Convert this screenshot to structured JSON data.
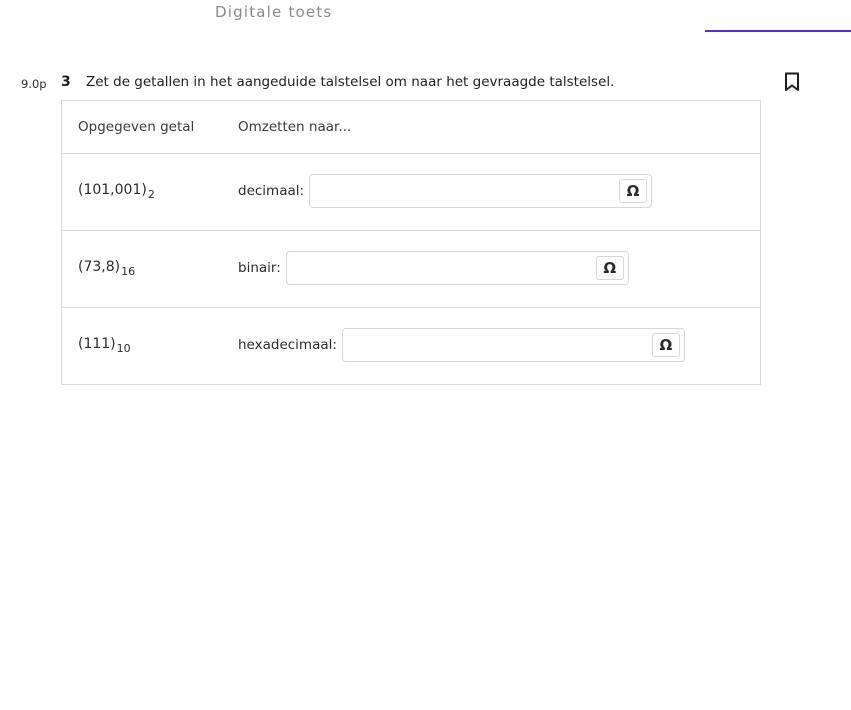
{
  "header": {
    "title": "Digitale toets"
  },
  "question": {
    "points": "9.0p",
    "number": "3",
    "text": "Zet de getallen in het aangeduide talstelsel om naar het gevraagde talstelsel.",
    "bookmark_icon": "bookmark-icon"
  },
  "table": {
    "col_given": "Opgegeven getal",
    "col_target": "Omzetten naar...",
    "rows": [
      {
        "number": "(101,001)",
        "base": "2",
        "target_label": "decimaal:",
        "value": "",
        "special_char_symbol": "Ω"
      },
      {
        "number": "(73,8)",
        "base": "16",
        "target_label": "binair:",
        "value": "",
        "special_char_symbol": "Ω"
      },
      {
        "number": "(111)",
        "base": "10",
        "target_label": "hexadecimaal:",
        "value": "",
        "special_char_symbol": "Ω"
      }
    ]
  },
  "colors": {
    "accent": "#5b2bd0",
    "border": "#d9d9d9",
    "text": "#2b2b2b",
    "muted": "#8a8a8a"
  }
}
